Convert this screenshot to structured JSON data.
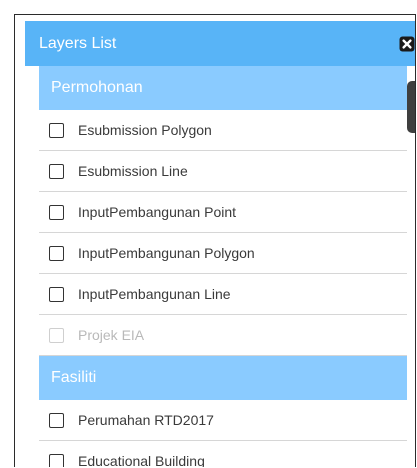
{
  "panel": {
    "title": "Layers List",
    "close_icon": "close-icon"
  },
  "colors": {
    "header_bg": "#58b4f7",
    "group_bg": "#8acbff",
    "border": "#d6d6d6"
  },
  "groups": [
    {
      "label": "Permohonan",
      "items": [
        {
          "label": "Esubmission Polygon",
          "checked": false,
          "enabled": true
        },
        {
          "label": "Esubmission Line",
          "checked": false,
          "enabled": true
        },
        {
          "label": "InputPembangunan Point",
          "checked": false,
          "enabled": true
        },
        {
          "label": "InputPembangunan Polygon",
          "checked": false,
          "enabled": true
        },
        {
          "label": "InputPembangunan Line",
          "checked": false,
          "enabled": true
        },
        {
          "label": "Projek EIA",
          "checked": false,
          "enabled": false
        }
      ]
    },
    {
      "label": "Fasiliti",
      "items": [
        {
          "label": "Perumahan RTD2017",
          "checked": false,
          "enabled": true
        },
        {
          "label": "Educational Building",
          "checked": false,
          "enabled": true
        }
      ]
    }
  ]
}
